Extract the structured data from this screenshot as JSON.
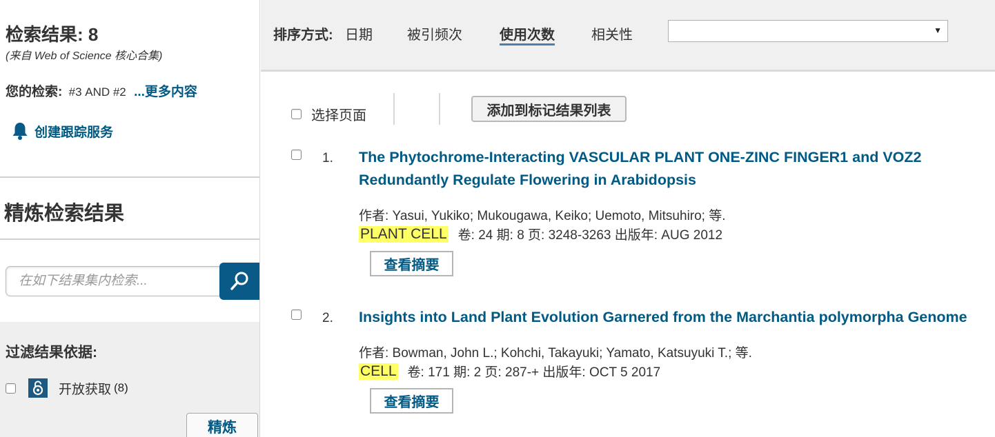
{
  "sidebar": {
    "results_label": "检索结果:",
    "results_count": "8",
    "results_source": "(来自 Web of Science 核心合集)",
    "your_search_label": "您的检索:",
    "your_search_query": "#3 AND #2",
    "more_link": "...更多内容",
    "create_alert": "创建跟踪服务",
    "refine_title": "精炼检索结果",
    "search_placeholder": "在如下结果集内检索...",
    "filter_title": "过滤结果依据:",
    "filter_label": "开放获取",
    "filter_count": "(8)",
    "refine_button": "精炼"
  },
  "sortbar": {
    "label": "排序方式:",
    "options": [
      "日期",
      "被引频次",
      "使用次数",
      "相关性"
    ],
    "active": "使用次数",
    "select_value": ""
  },
  "toolbar": {
    "select_page": "选择页面",
    "add_to_marked": "添加到标记结果列表"
  },
  "records": [
    {
      "num": "1.",
      "title": "The Phytochrome-Interacting VASCULAR PLANT ONE-ZINC FINGER1 and VOZ2 Redundantly Regulate Flowering in Arabidopsis",
      "authors": "作者: Yasui, Yukiko; Mukougawa, Keiko; Uemoto, Mitsuhiro; 等.",
      "journal": "PLANT CELL",
      "meta": "卷: 24   期: 8   页: 3248-3263   出版年: AUG 2012",
      "abstract_button": "查看摘要"
    },
    {
      "num": "2.",
      "title": "Insights into Land Plant Evolution Garnered from the Marchantia polymorpha Genome",
      "authors": "作者: Bowman, John L.; Kohchi, Takayuki; Yamato, Katsuyuki T.; 等.",
      "journal": "CELL",
      "meta": "卷: 171   期: 2   页: 287-+   出版年: OCT 5 2017",
      "abstract_button": "查看摘要"
    }
  ],
  "colors": {
    "link_blue": "#005a84",
    "search_button": "#0a5a88",
    "journal_highlight": "#ffff66",
    "sortbar_bg": "#f0f0f0",
    "filter_bg": "#efefef"
  },
  "icons": {
    "alert": "bell-icon",
    "search": "magnifier-icon",
    "open_access": "open-access-icon",
    "select": "chevron-down-icon"
  }
}
